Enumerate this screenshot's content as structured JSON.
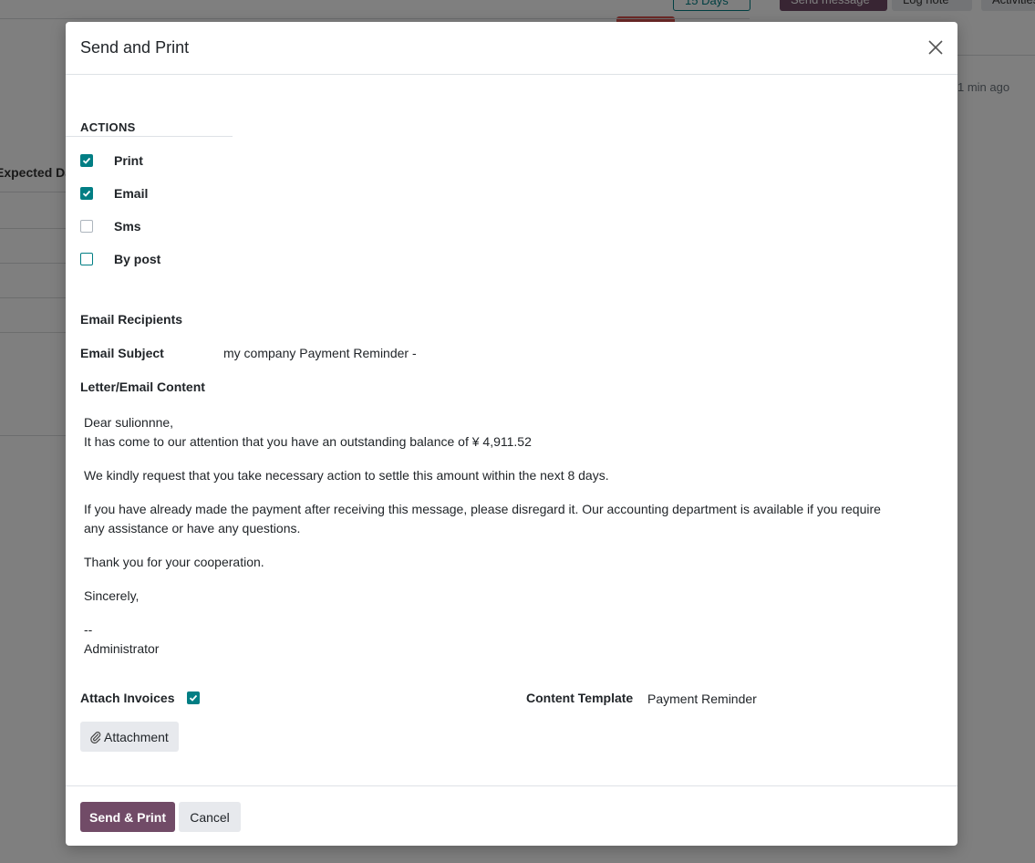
{
  "background": {
    "days_badge": "15 Days",
    "send_message": "Send message",
    "log_note": "Log note",
    "activities": "Activities",
    "chatter_time": "1 min ago",
    "table_header": "Expected Date"
  },
  "modal": {
    "title": "Send and Print",
    "actions_title": "ACTIONS",
    "actions": [
      {
        "label": "Print",
        "checked": true
      },
      {
        "label": "Email",
        "checked": true
      },
      {
        "label": "Sms",
        "checked": false
      },
      {
        "label": "By post",
        "checked": false
      }
    ],
    "email_recipients_label": "Email Recipients",
    "email_subject_label": "Email Subject",
    "email_subject_value": "my company Payment Reminder -",
    "content_label": "Letter/Email Content",
    "content": {
      "greeting": "Dear sulionnne,",
      "line1": "It has come to our attention that you have an outstanding balance of ¥ 4,911.52",
      "line2": "We kindly request that you take necessary action to settle this amount within the next 8 days.",
      "line3": "If you have already made the payment after receiving this message, please disregard it. Our accounting department is available if you require any assistance or have any questions.",
      "line4": "Thank you for your cooperation.",
      "line5": "Sincerely,",
      "sig_dash": "--",
      "sig_name": "Administrator"
    },
    "attach_invoices_label": "Attach Invoices",
    "attach_invoices_checked": true,
    "content_template_label": "Content Template",
    "content_template_value": "Payment Reminder",
    "attachment_button": "Attachment",
    "send_button": "Send & Print",
    "cancel_button": "Cancel"
  },
  "colors": {
    "primary": "#714b67",
    "teal": "#017e84",
    "secondary_bg": "#e7e9ed"
  }
}
